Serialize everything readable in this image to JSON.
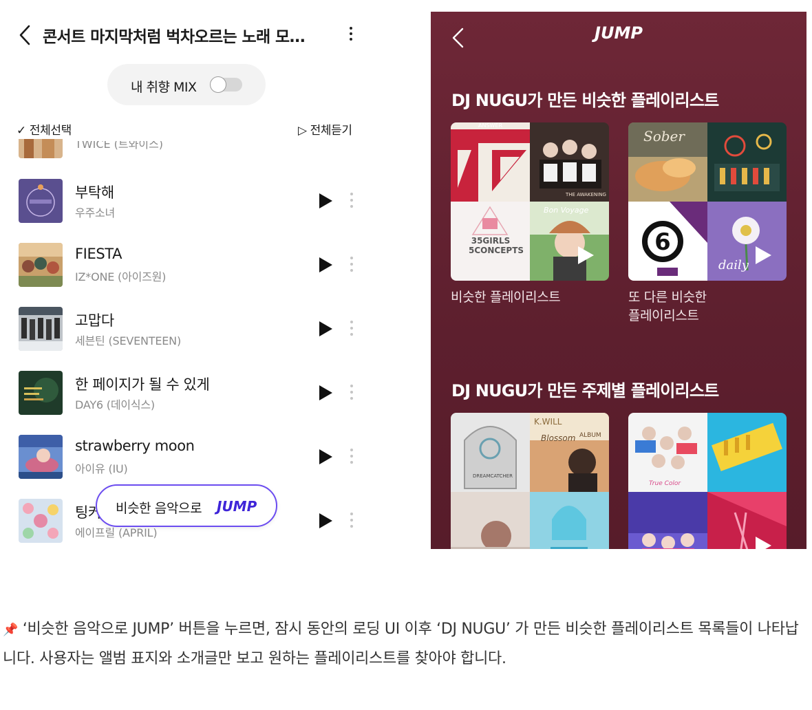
{
  "left_screen": {
    "header": {
      "title": "콘서트 마지막처럼 벅차오르는 노래 모…"
    },
    "mix": {
      "label": "내 취향 MIX"
    },
    "select_all_label": "✓ 전체선택",
    "play_all_label": "▷ 전체듣기",
    "partial_artist": "TWICE (트와이스)",
    "songs": [
      {
        "title": "부탁해",
        "artist": "우주소녀"
      },
      {
        "title": "FIESTA",
        "artist": "IZ*ONE (아이즈원)"
      },
      {
        "title": "고맙다",
        "artist": "세븐틴 (SEVENTEEN)"
      },
      {
        "title": "한 페이지가 될 수 있게",
        "artist": "DAY6 (데이식스)"
      },
      {
        "title": "strawberry moon",
        "artist": "아이유 (IU)"
      },
      {
        "title": "팅커벨",
        "artist": "에이프릴 (APRIL)"
      }
    ],
    "jump_button": {
      "text": "비슷한 음악으로",
      "accent": "JUMP"
    }
  },
  "right_screen": {
    "title": "JUMP",
    "section1": {
      "heading": "DJ NUGU가 만든 비슷한 플레이리스트",
      "cards": [
        {
          "caption": "비슷한 플레이리스트",
          "covers": [
            "ANSWER",
            "THE AWAKENING",
            "35GIRLS 5CONCEPTS",
            "Bon Voyage"
          ]
        },
        {
          "caption_line1": "또 다른 비슷한",
          "caption_line2": "플레이리스트",
          "covers": [
            "Sober",
            "",
            "6",
            "daily"
          ]
        }
      ]
    },
    "section2": {
      "heading": "DJ NUGU가 만든 주제별 플레이리스트",
      "cover_texts": [
        "DREAMCATCHER",
        "K.WILL",
        "Blossom",
        "ALBUM",
        "True Color"
      ]
    }
  },
  "caption": {
    "pin_icon": "📌",
    "text": "‘비슷한 음악으로 JUMP’ 버튼을 누르면, 잠시 동안의 로딩 UI 이후 ‘DJ NUGU’ 가 만든 비슷한 플레이리스트 목록들이 나타납니다. 사용자는 앨범 표지와 소개글만 보고 원하는 플레이리스트를 찾아야 합니다."
  },
  "colors": {
    "jump_accent": "#3f25d8",
    "jump_border": "#6b4cf0",
    "panel_bg": "#6e2737"
  },
  "icons": [
    "back-chevron-icon",
    "more-vertical-icon",
    "toggle-icon",
    "play-icon",
    "pin-icon"
  ]
}
